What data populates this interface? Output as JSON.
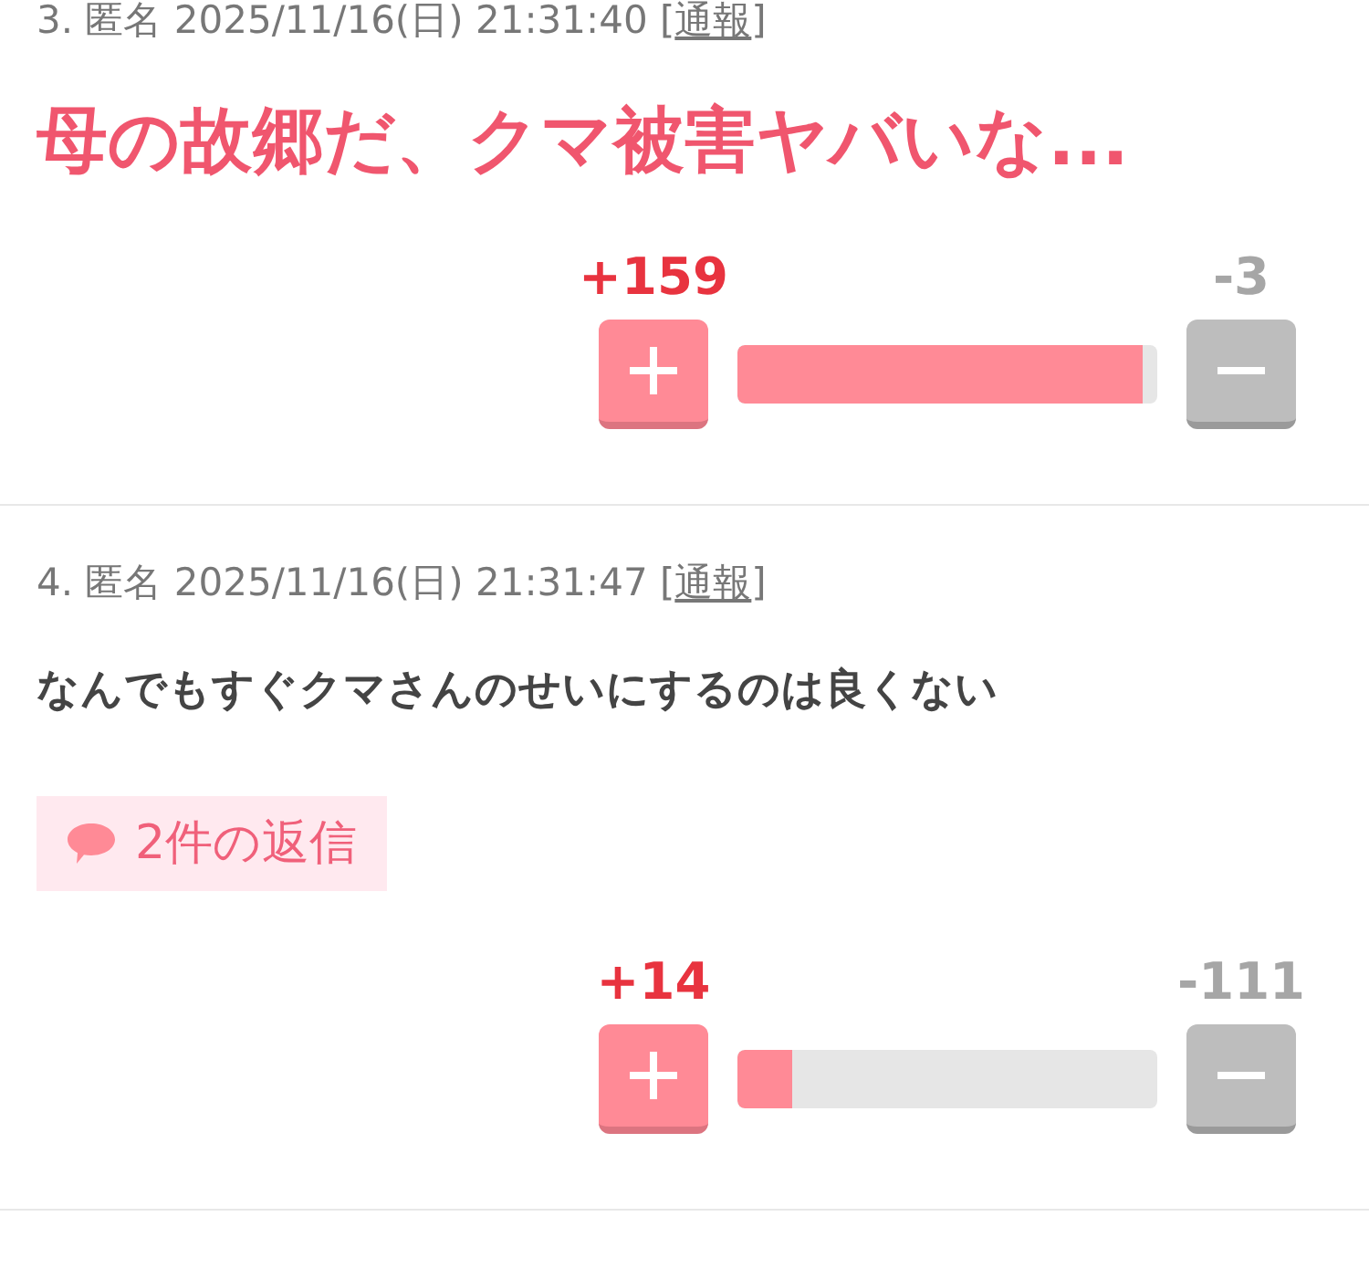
{
  "comments": [
    {
      "meta_before": "3. 匿名 2025/11/16(日) 21:31:40 [",
      "report_link": "通報",
      "meta_after": "]",
      "kind": "headline",
      "text": "母の故郷だ、クマ被害ヤバいな...",
      "votes": {
        "plus_count": "+159",
        "minus_count": "-3",
        "level": 0.965
      }
    },
    {
      "meta_before": "4. 匿名 2025/11/16(日) 21:31:47 [",
      "report_link": "通報",
      "meta_after": "]",
      "kind": "text",
      "text": "なんでもすぐクマさんのせいにするのは良くない",
      "replies": {
        "label": "2件の返信"
      },
      "votes": {
        "plus_count": "+14",
        "minus_count": "-111",
        "level": 0.13
      }
    }
  ]
}
